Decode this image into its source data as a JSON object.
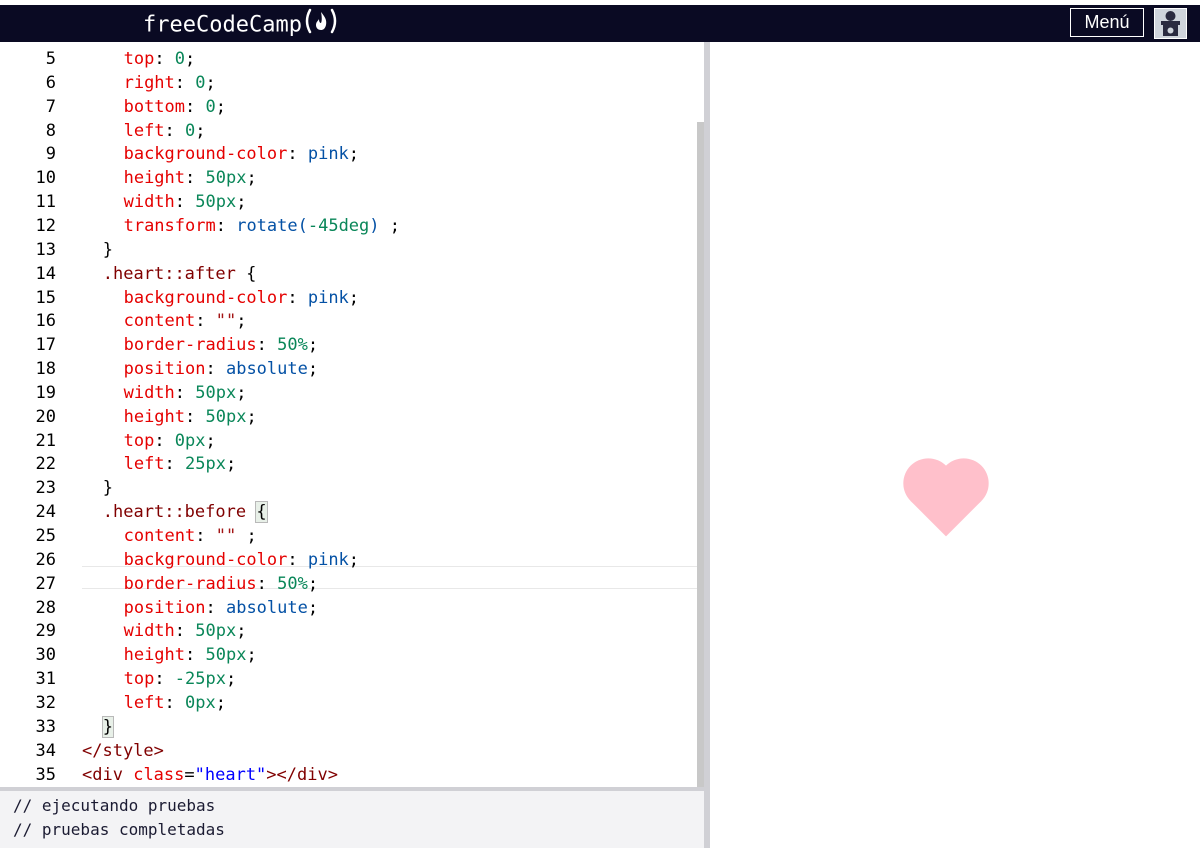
{
  "navbar": {
    "brand": "freeCodeCamp",
    "menu_label": "Menú",
    "flame_icon": "flame-icon",
    "avatar_icon": "user-avatar-icon"
  },
  "editor": {
    "lines": [
      {
        "num": "5",
        "tokens": [
          [
            "p",
            "top"
          ],
          [
            "d",
            ": "
          ],
          [
            "n",
            "0"
          ],
          [
            "d",
            ";"
          ]
        ],
        "indent": 4
      },
      {
        "num": "6",
        "tokens": [
          [
            "p",
            "right"
          ],
          [
            "d",
            ": "
          ],
          [
            "n",
            "0"
          ],
          [
            "d",
            ";"
          ]
        ],
        "indent": 4
      },
      {
        "num": "7",
        "tokens": [
          [
            "p",
            "bottom"
          ],
          [
            "d",
            ": "
          ],
          [
            "n",
            "0"
          ],
          [
            "d",
            ";"
          ]
        ],
        "indent": 4
      },
      {
        "num": "8",
        "tokens": [
          [
            "p",
            "left"
          ],
          [
            "d",
            ": "
          ],
          [
            "n",
            "0"
          ],
          [
            "d",
            ";"
          ]
        ],
        "indent": 4
      },
      {
        "num": "9",
        "tokens": [
          [
            "p",
            "background-color"
          ],
          [
            "d",
            ": "
          ],
          [
            "v",
            "pink"
          ],
          [
            "d",
            ";"
          ]
        ],
        "indent": 4
      },
      {
        "num": "10",
        "tokens": [
          [
            "p",
            "height"
          ],
          [
            "d",
            ": "
          ],
          [
            "n",
            "50px"
          ],
          [
            "d",
            ";"
          ]
        ],
        "indent": 4
      },
      {
        "num": "11",
        "tokens": [
          [
            "p",
            "width"
          ],
          [
            "d",
            ": "
          ],
          [
            "n",
            "50px"
          ],
          [
            "d",
            ";"
          ]
        ],
        "indent": 4
      },
      {
        "num": "12",
        "tokens": [
          [
            "p",
            "transform"
          ],
          [
            "d",
            ": "
          ],
          [
            "v",
            "rotate("
          ],
          [
            "n",
            "-45deg"
          ],
          [
            "v",
            ")"
          ],
          [
            "d",
            " ;"
          ]
        ],
        "indent": 4
      },
      {
        "num": "13",
        "tokens": [
          [
            "d",
            "}"
          ]
        ],
        "indent": 2
      },
      {
        "num": "14",
        "tokens": [
          [
            "t",
            ".heart::after"
          ],
          [
            "d",
            " {"
          ]
        ],
        "indent": 2
      },
      {
        "num": "15",
        "tokens": [
          [
            "p",
            "background-color"
          ],
          [
            "d",
            ": "
          ],
          [
            "v",
            "pink"
          ],
          [
            "d",
            ";"
          ]
        ],
        "indent": 4
      },
      {
        "num": "16",
        "tokens": [
          [
            "p",
            "content"
          ],
          [
            "d",
            ": "
          ],
          [
            "s",
            "\"\""
          ],
          [
            "d",
            ";"
          ]
        ],
        "indent": 4
      },
      {
        "num": "17",
        "tokens": [
          [
            "p",
            "border-radius"
          ],
          [
            "d",
            ": "
          ],
          [
            "n",
            "50%"
          ],
          [
            "d",
            ";"
          ]
        ],
        "indent": 4
      },
      {
        "num": "18",
        "tokens": [
          [
            "p",
            "position"
          ],
          [
            "d",
            ": "
          ],
          [
            "v",
            "absolute"
          ],
          [
            "d",
            ";"
          ]
        ],
        "indent": 4
      },
      {
        "num": "19",
        "tokens": [
          [
            "p",
            "width"
          ],
          [
            "d",
            ": "
          ],
          [
            "n",
            "50px"
          ],
          [
            "d",
            ";"
          ]
        ],
        "indent": 4
      },
      {
        "num": "20",
        "tokens": [
          [
            "p",
            "height"
          ],
          [
            "d",
            ": "
          ],
          [
            "n",
            "50px"
          ],
          [
            "d",
            ";"
          ]
        ],
        "indent": 4
      },
      {
        "num": "21",
        "tokens": [
          [
            "p",
            "top"
          ],
          [
            "d",
            ": "
          ],
          [
            "n",
            "0px"
          ],
          [
            "d",
            ";"
          ]
        ],
        "indent": 4
      },
      {
        "num": "22",
        "tokens": [
          [
            "p",
            "left"
          ],
          [
            "d",
            ": "
          ],
          [
            "n",
            "25px"
          ],
          [
            "d",
            ";"
          ]
        ],
        "indent": 4
      },
      {
        "num": "23",
        "tokens": [
          [
            "d",
            "}"
          ]
        ],
        "indent": 2
      },
      {
        "num": "24",
        "tokens": [
          [
            "t",
            ".heart::before"
          ],
          [
            "d",
            " "
          ],
          [
            "m",
            "{"
          ]
        ],
        "indent": 2
      },
      {
        "num": "25",
        "tokens": [
          [
            "p",
            "content"
          ],
          [
            "d",
            ": "
          ],
          [
            "s",
            "\"\""
          ],
          [
            "d",
            " ;"
          ]
        ],
        "indent": 4
      },
      {
        "num": "26",
        "tokens": [
          [
            "p",
            "background-color"
          ],
          [
            "d",
            ": "
          ],
          [
            "v",
            "pink"
          ],
          [
            "d",
            ";"
          ]
        ],
        "indent": 4
      },
      {
        "num": "27",
        "tokens": [
          [
            "p",
            "border-radius"
          ],
          [
            "d",
            ": "
          ],
          [
            "n",
            "50%"
          ],
          [
            "d",
            ";"
          ]
        ],
        "indent": 4
      },
      {
        "num": "28",
        "tokens": [
          [
            "p",
            "position"
          ],
          [
            "d",
            ": "
          ],
          [
            "v",
            "absolute"
          ],
          [
            "d",
            ";"
          ]
        ],
        "indent": 4
      },
      {
        "num": "29",
        "tokens": [
          [
            "p",
            "width"
          ],
          [
            "d",
            ": "
          ],
          [
            "n",
            "50px"
          ],
          [
            "d",
            ";"
          ]
        ],
        "indent": 4
      },
      {
        "num": "30",
        "tokens": [
          [
            "p",
            "height"
          ],
          [
            "d",
            ": "
          ],
          [
            "n",
            "50px"
          ],
          [
            "d",
            ";"
          ]
        ],
        "indent": 4
      },
      {
        "num": "31",
        "tokens": [
          [
            "p",
            "top"
          ],
          [
            "d",
            ": "
          ],
          [
            "n",
            "-25px"
          ],
          [
            "d",
            ";"
          ]
        ],
        "indent": 4
      },
      {
        "num": "32",
        "tokens": [
          [
            "p",
            "left"
          ],
          [
            "d",
            ": "
          ],
          [
            "n",
            "0px"
          ],
          [
            "d",
            ";"
          ]
        ],
        "indent": 4
      },
      {
        "num": "33",
        "tokens": [
          [
            "m",
            "}"
          ]
        ],
        "indent": 2
      },
      {
        "num": "34",
        "tokens": [
          [
            "t",
            "</style>"
          ]
        ],
        "indent": 0
      },
      {
        "num": "35",
        "tokens": [
          [
            "t",
            "<div"
          ],
          [
            "d",
            " "
          ],
          [
            "a",
            "class"
          ],
          [
            "d",
            "="
          ],
          [
            "av",
            "\"heart\""
          ],
          [
            "t",
            "></div>"
          ]
        ],
        "indent": 0
      }
    ]
  },
  "console": {
    "line1": "// ejecutando pruebas",
    "line2": "// pruebas completadas"
  },
  "colors": {
    "navbar_bg": "#0a0a23",
    "heart": "pink",
    "console_bg": "#f3f3f5"
  }
}
